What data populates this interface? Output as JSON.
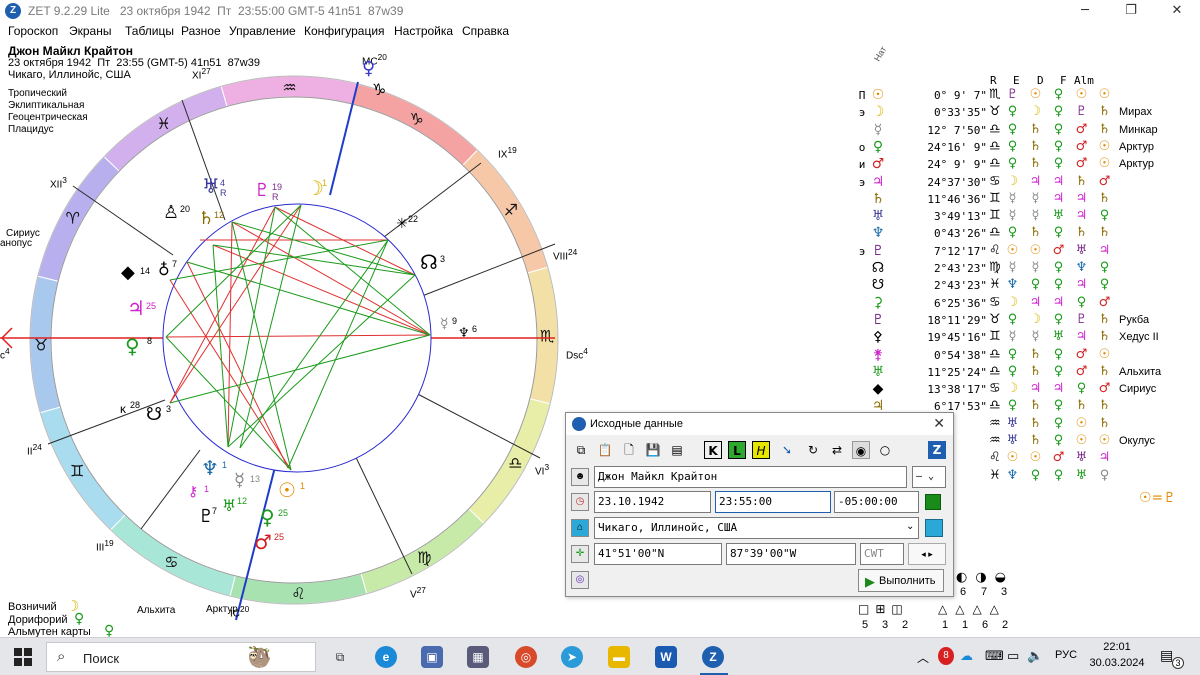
{
  "window": {
    "title": "ZET 9.2.29 Lite   23 октября 1942  Пт  23:55:00 GMT-5 41n51  87w39",
    "app_icon": "zet-logo-icon"
  },
  "menu": [
    "Гороскоп",
    "Экраны",
    "Таблицы",
    "Разное",
    "Управление",
    "Конфигурация",
    "Настройка",
    "Справка"
  ],
  "chart_header": {
    "name": "Джон Майкл Крайтон",
    "datetime": "23 октября 1942  Пт  23:55 (GMT-5) 41n51  87w39",
    "place": "Чикаго, Иллинойс, США",
    "settings": [
      "Тропический",
      "Эклиптикальная",
      "Геоцентрическая",
      "Плацидус"
    ]
  },
  "wheel": {
    "house_labels": {
      "mc": "MC",
      "mc_deg": "20",
      "h9": "IX",
      "h9_deg": "19",
      "h8": "VIII",
      "h8_deg": "24",
      "dsc": "Dsc",
      "dsc_deg": "4",
      "h6": "VI",
      "h6_deg": "3",
      "h5": "V",
      "h5_deg": "27",
      "ic": "IC",
      "ic_deg": "20",
      "h3": "III",
      "h3_deg": "19",
      "h2": "II",
      "h2_deg": "24",
      "asc": "c",
      "asc_deg": "4",
      "h12": "XII",
      "h12_deg": "3",
      "h11": "XI",
      "h11_deg": "27"
    },
    "left_labels": [
      "Сириус",
      "анопус"
    ],
    "bottom_labels": {
      "alhita": "Альхита",
      "arktur": "Арктур"
    },
    "planet_degs": {
      "moon": "1",
      "uranus": "4",
      "uranus_r": "R",
      "pluto_h": "19",
      "pluto_h_r": "R",
      "vertex": "20",
      "saturn": "12",
      "node": "3",
      "chiron": "22",
      "black": "14",
      "jup": "25",
      "cupido": "7",
      "venus_asc": "8",
      "lot": "28",
      "south_node": "3",
      "neptune": "1",
      "chiron2": "1",
      "pluto": "7",
      "hebe": "12",
      "mercury": "13",
      "sun": "1",
      "venus": "25",
      "mars": "25",
      "urania": "9",
      "pholus": "6"
    }
  },
  "positions_header": {
    "nat": "Нат",
    "cols": [
      "R",
      "E",
      "D",
      "F",
      "Alm"
    ]
  },
  "positions": [
    {
      "letter": "П",
      "glyph": "☉",
      "color": "#e08a00",
      "deg": "0° 9' 7\"",
      "sign": "♏",
      "rulers": [
        "♇",
        "☉",
        "♀",
        "☉",
        "☉"
      ],
      "rcolors": [
        "#7a2a8a",
        "#e08a00",
        "#1a9a1a",
        "#e08a00",
        "#e08a00"
      ],
      "star": ""
    },
    {
      "letter": "э",
      "glyph": "☽",
      "color": "#d8b400",
      "deg": "0°33'35\"",
      "sign": "♉",
      "rulers": [
        "♀",
        "☽",
        "♀",
        "♇",
        "♄"
      ],
      "rcolors": [
        "#1a9a1a",
        "#d8b400",
        "#1a9a1a",
        "#7a2a8a",
        "#8a6a00"
      ],
      "star": "Мирах"
    },
    {
      "letter": "",
      "glyph": "☿",
      "color": "#888888",
      "deg": "12° 7'50\"",
      "sign": "♎",
      "rulers": [
        "♀",
        "♄",
        "♀",
        "♂",
        "♄"
      ],
      "rcolors": [
        "#1a9a1a",
        "#8a6a00",
        "#1a9a1a",
        "#d02020",
        "#8a6a00"
      ],
      "star": "Минкар"
    },
    {
      "letter": "о",
      "glyph": "♀",
      "color": "#1a9a1a",
      "deg": "24°16' 9\"",
      "sign": "♎",
      "rulers": [
        "♀",
        "♄",
        "♀",
        "♂",
        "☉"
      ],
      "rcolors": [
        "#1a9a1a",
        "#8a6a00",
        "#1a9a1a",
        "#d02020",
        "#e08a00"
      ],
      "star": "Арктур"
    },
    {
      "letter": "и",
      "glyph": "♂",
      "color": "#d02020",
      "deg": "24° 9' 9\"",
      "sign": "♎",
      "rulers": [
        "♀",
        "♄",
        "♀",
        "♂",
        "☉"
      ],
      "rcolors": [
        "#1a9a1a",
        "#8a6a00",
        "#1a9a1a",
        "#d02020",
        "#e08a00"
      ],
      "star": "Арктур"
    },
    {
      "letter": "э",
      "glyph": "♃",
      "color": "#cc22cc",
      "deg": "24°37'30\"",
      "sign": "♋",
      "rulers": [
        "☽",
        "♃",
        "♃",
        "♄",
        "♂"
      ],
      "rcolors": [
        "#d8b400",
        "#cc22cc",
        "#cc22cc",
        "#8a6a00",
        "#d02020"
      ],
      "star": ""
    },
    {
      "letter": "",
      "glyph": "♄",
      "color": "#8a6a00",
      "deg": "11°46'36\"",
      "sign": "♊",
      "rulers": [
        "☿",
        "☿",
        "♃",
        "♃",
        "♄"
      ],
      "rcolors": [
        "#888888",
        "#888888",
        "#cc22cc",
        "#cc22cc",
        "#8a6a00"
      ],
      "star": ""
    },
    {
      "letter": "",
      "glyph": "♅",
      "color": "#3a3a9a",
      "deg": "3°49'13\"",
      "sign": "♊",
      "rulers": [
        "☿",
        "☿",
        "♅",
        "♃",
        "♀"
      ],
      "rcolors": [
        "#888888",
        "#888888",
        "#1a9a1a",
        "#cc22cc",
        "#1a9a1a"
      ],
      "star": ""
    },
    {
      "letter": "",
      "glyph": "♆",
      "color": "#1a6aa8",
      "deg": "0°43'26\"",
      "sign": "♎",
      "rulers": [
        "♀",
        "♄",
        "♀",
        "♄",
        "♄"
      ],
      "rcolors": [
        "#1a9a1a",
        "#8a6a00",
        "#1a9a1a",
        "#8a6a00",
        "#8a6a00"
      ],
      "star": ""
    },
    {
      "letter": "э",
      "glyph": "♇",
      "color": "#7a2a8a",
      "deg": "7°12'17\"",
      "sign": "♌",
      "rulers": [
        "☉",
        "☉",
        "♂",
        "♅",
        "♃"
      ],
      "rcolors": [
        "#e08a00",
        "#e08a00",
        "#d02020",
        "#7a2a8a",
        "#cc22cc"
      ],
      "star": ""
    },
    {
      "letter": "",
      "glyph": "☊",
      "color": "#000000",
      "deg": "2°43'23\"",
      "sign": "♍",
      "rulers": [
        "☿",
        "☿",
        "♀",
        "♆",
        "♀"
      ],
      "rcolors": [
        "#888888",
        "#888888",
        "#1a9a1a",
        "#1a6aa8",
        "#1a9a1a"
      ],
      "star": ""
    },
    {
      "letter": "",
      "glyph": "☋",
      "color": "#000000",
      "deg": "2°43'23\"",
      "sign": "♓",
      "rulers": [
        "♆",
        "♀",
        "♀",
        "♃",
        "♀"
      ],
      "rcolors": [
        "#1a6aa8",
        "#1a9a1a",
        "#1a9a1a",
        "#cc22cc",
        "#1a9a1a"
      ],
      "star": ""
    },
    {
      "letter": "",
      "glyph": "⚳",
      "color": "#1a9a1a",
      "deg": "6°25'36\"",
      "sign": "♋",
      "rulers": [
        "☽",
        "♃",
        "♃",
        "♀",
        "♂"
      ],
      "rcolors": [
        "#d8b400",
        "#cc22cc",
        "#cc22cc",
        "#1a9a1a",
        "#d02020"
      ],
      "star": ""
    },
    {
      "letter": "",
      "glyph": "♇",
      "color": "#7a2a8a",
      "deg": "18°11'29\"",
      "sign": "♉",
      "rulers": [
        "♀",
        "☽",
        "♀",
        "♇",
        "♄"
      ],
      "rcolors": [
        "#1a9a1a",
        "#d8b400",
        "#1a9a1a",
        "#7a2a8a",
        "#8a6a00"
      ],
      "star": "Рукба"
    },
    {
      "letter": "",
      "glyph": "⚴",
      "color": "#000000",
      "deg": "19°45'16\"",
      "sign": "♊",
      "rulers": [
        "☿",
        "☿",
        "♅",
        "♃",
        "♄"
      ],
      "rcolors": [
        "#888888",
        "#888888",
        "#1a9a1a",
        "#cc22cc",
        "#8a6a00"
      ],
      "star": "Хедус II"
    },
    {
      "letter": "",
      "glyph": "⚵",
      "color": "#cc22cc",
      "deg": "0°54'38\"",
      "sign": "♎",
      "rulers": [
        "♀",
        "♄",
        "♀",
        "♂",
        "☉"
      ],
      "rcolors": [
        "#1a9a1a",
        "#8a6a00",
        "#1a9a1a",
        "#d02020",
        "#e08a00"
      ],
      "star": ""
    },
    {
      "letter": "",
      "glyph": "♅",
      "color": "#1a9a1a",
      "deg": "11°25'24\"",
      "sign": "♎",
      "rulers": [
        "♀",
        "♄",
        "♀",
        "♂",
        "♄"
      ],
      "rcolors": [
        "#1a9a1a",
        "#8a6a00",
        "#1a9a1a",
        "#d02020",
        "#8a6a00"
      ],
      "star": "Альхита"
    },
    {
      "letter": "",
      "glyph": "◆",
      "color": "#000000",
      "deg": "13°38'17\"",
      "sign": "♋",
      "rulers": [
        "☽",
        "♃",
        "♃",
        "♀",
        "♂"
      ],
      "rcolors": [
        "#d8b400",
        "#cc22cc",
        "#cc22cc",
        "#1a9a1a",
        "#d02020"
      ],
      "star": "Сириус"
    },
    {
      "letter": "",
      "glyph": "♃",
      "color": "#8a6a00",
      "deg": "6°17'53\"",
      "sign": "♎",
      "rulers": [
        "♀",
        "♄",
        "♀",
        "♄",
        "♄"
      ],
      "rcolors": [
        "#1a9a1a",
        "#8a6a00",
        "#1a9a1a",
        "#8a6a00",
        "#8a6a00"
      ],
      "star": ""
    },
    {
      "letter": "",
      "glyph": "♂",
      "color": "#000000",
      "deg": "",
      "sign": "♒",
      "rulers": [
        "♅",
        "♄",
        "♀",
        "☉",
        "♄"
      ],
      "rcolors": [
        "#3a3a9a",
        "#8a6a00",
        "#1a9a1a",
        "#e08a00",
        "#8a6a00"
      ],
      "star": ""
    },
    {
      "letter": "",
      "glyph": "♂",
      "color": "#000000",
      "deg": "",
      "sign": "♒",
      "rulers": [
        "♅",
        "♄",
        "♀",
        "☉",
        "☉"
      ],
      "rcolors": [
        "#3a3a9a",
        "#8a6a00",
        "#1a9a1a",
        "#e08a00",
        "#e08a00"
      ],
      "star": "Окулус"
    },
    {
      "letter": "",
      "glyph": "♂",
      "color": "#000000",
      "deg": "",
      "sign": "♌",
      "rulers": [
        "☉",
        "☉",
        "♂",
        "♅",
        "♃"
      ],
      "rcolors": [
        "#e08a00",
        "#e08a00",
        "#d02020",
        "#7a2a8a",
        "#cc22cc"
      ],
      "star": ""
    },
    {
      "letter": "",
      "glyph": "♂",
      "color": "#000000",
      "deg": "",
      "sign": "♓",
      "rulers": [
        "♆",
        "♀",
        "♀",
        "♅",
        "♀"
      ],
      "rcolors": [
        "#1a6aa8",
        "#1a9a1a",
        "#1a9a1a",
        "#1a9a1a",
        "#888888"
      ],
      "star": ""
    }
  ],
  "sun_pluto_label": "☉=♇",
  "bottom_left": [
    {
      "label": "Возничий",
      "glyph": "☽",
      "color": "#d8b400"
    },
    {
      "label": "Дорифорий",
      "glyph": "♀",
      "color": "#1a9a1a"
    },
    {
      "label": "Альмутен карты",
      "glyph": "♀",
      "color": "#1a9a1a"
    }
  ],
  "stats_right": {
    "row1_numbers": [
      "6",
      "7",
      "3"
    ],
    "row2_numbers_a": [
      "5",
      "3",
      "2"
    ],
    "row2_numbers_b": [
      "1",
      "1",
      "6",
      "2"
    ]
  },
  "dialog": {
    "title": "Исходные данные",
    "close": "✕",
    "name_value": "Джон Майкл Крайтон",
    "gender_value": "—",
    "date_value": "23.10.1942",
    "time_value": "23:55:00",
    "tz_value": "-05:00:00",
    "place_value": "Чикаго, Иллинойс, США",
    "lat_value": "41°51'00\"N",
    "lon_value": "87°39'00\"W",
    "tz_code": "CWT",
    "run_label": "Выполнить"
  },
  "taskbar": {
    "search_placeholder": "Поиск",
    "lang": "РУС",
    "time": "22:01",
    "date": "30.03.2024",
    "notif_count": "3"
  }
}
